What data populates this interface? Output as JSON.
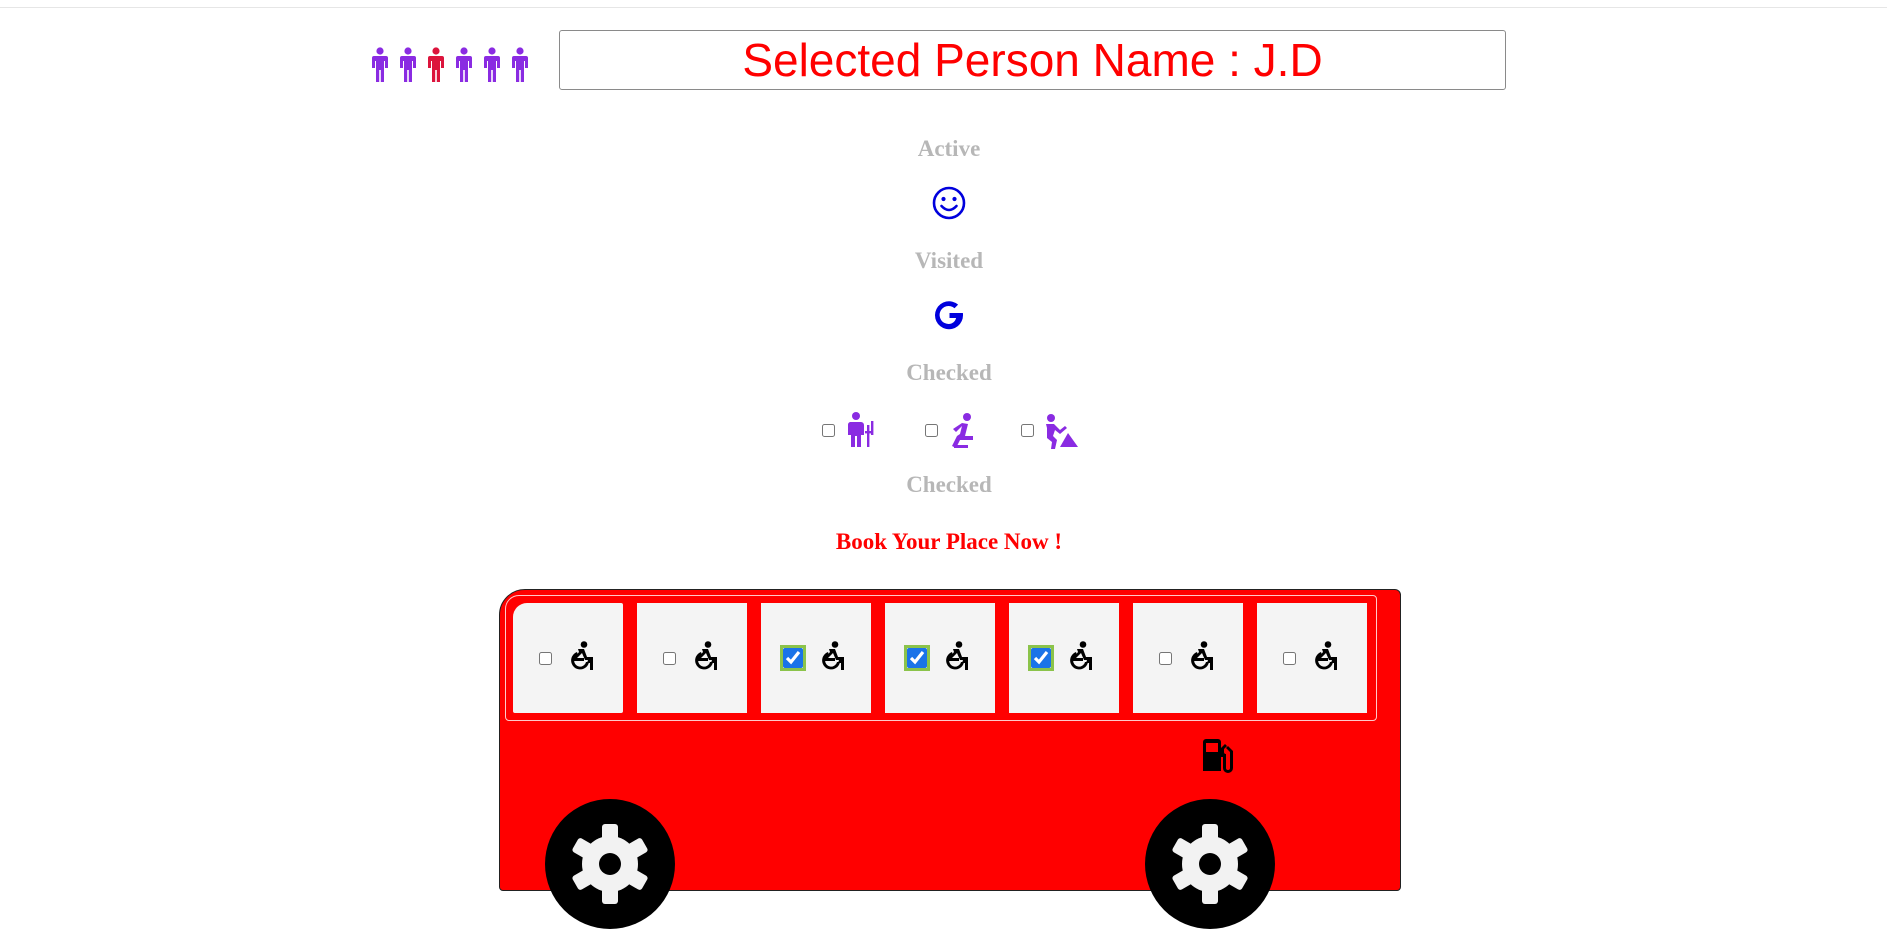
{
  "people": [
    {
      "name": "person-1",
      "color": "#8a2be2"
    },
    {
      "name": "person-2",
      "color": "#8a2be2"
    },
    {
      "name": "person-3",
      "color": "#dc143c"
    },
    {
      "name": "person-4",
      "color": "#8a2be2"
    },
    {
      "name": "person-5",
      "color": "#8a2be2"
    },
    {
      "name": "person-6",
      "color": "#8a2be2"
    }
  ],
  "header": {
    "selected_person": "Selected Person Name : J.D"
  },
  "labels": {
    "active": "Active",
    "visited": "Visited",
    "checked_1": "Checked",
    "checked_2": "Checked",
    "book": "Book Your Place Now !"
  },
  "icons": {
    "active": "smiley-icon",
    "visited": "google-g-icon",
    "fuel": "fuel-pump-icon",
    "wheel": "gear-icon",
    "seat": "wheelchair-icon"
  },
  "options": [
    {
      "icon": "person-with-cane-icon",
      "checked": false
    },
    {
      "icon": "kneeling-person-icon",
      "checked": false
    },
    {
      "icon": "person-digging-icon",
      "checked": false
    }
  ],
  "seats": [
    {
      "checked": false
    },
    {
      "checked": false
    },
    {
      "checked": true
    },
    {
      "checked": true
    },
    {
      "checked": true
    },
    {
      "checked": false
    },
    {
      "checked": false
    }
  ],
  "colors": {
    "accent_purple": "#8a2be2",
    "selected_red": "#dc143c",
    "bus_red": "#ff0000",
    "icon_blue": "#0000dd",
    "label_gray": "#b7b7b7"
  }
}
